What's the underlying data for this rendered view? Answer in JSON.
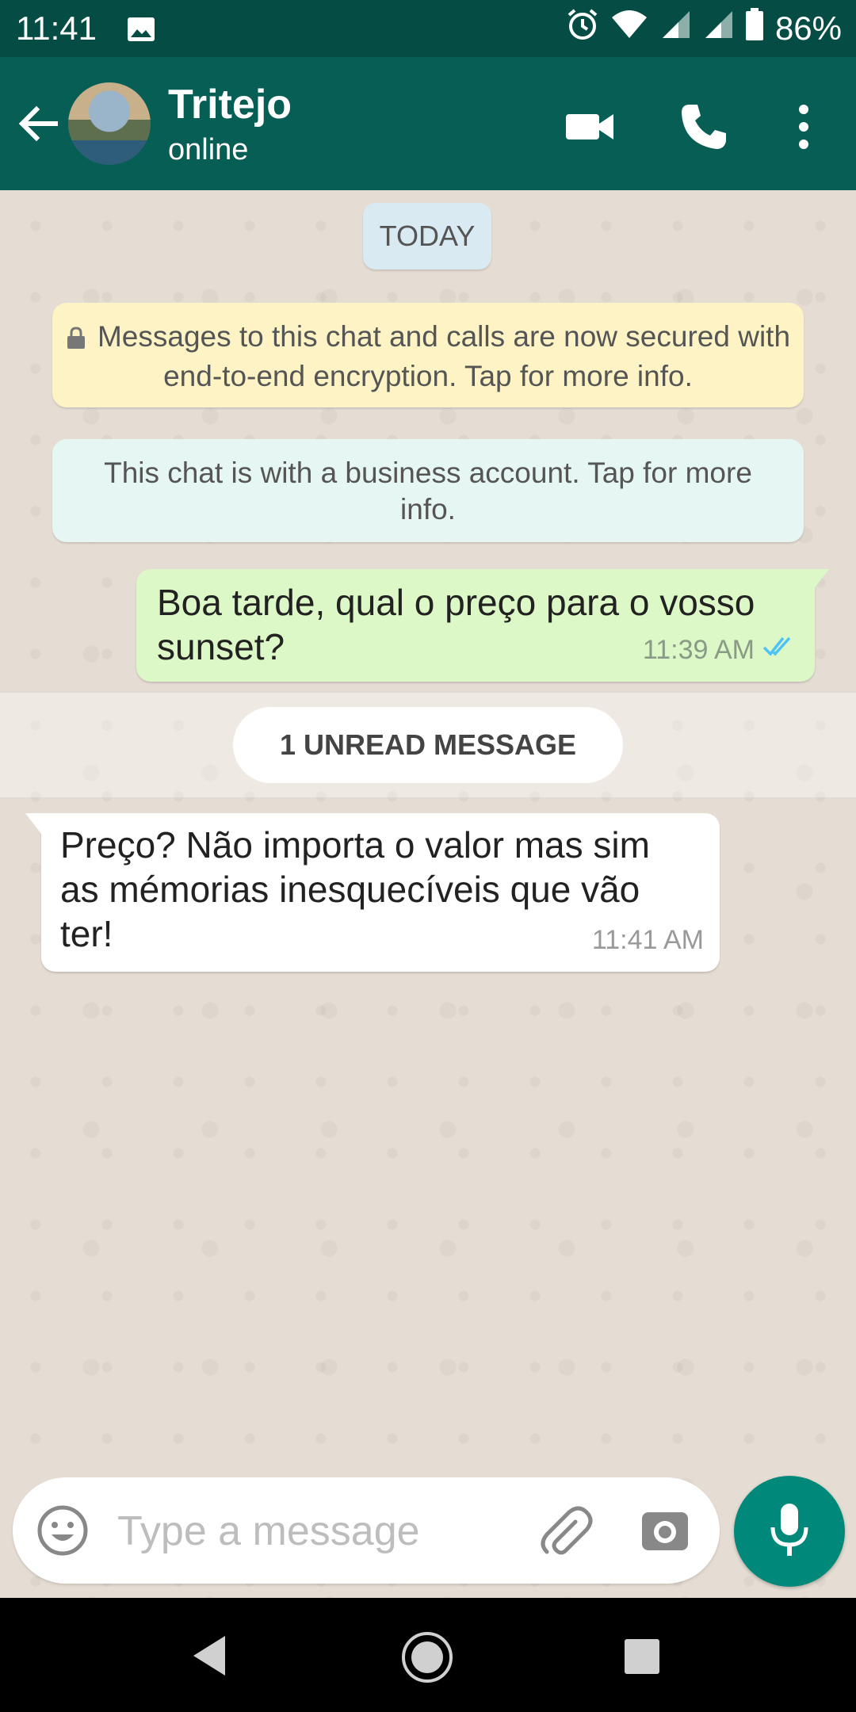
{
  "status_bar": {
    "time": "11:41",
    "battery_pct": "86%",
    "icons": [
      "image-icon",
      "alarm-icon",
      "wifi-icon",
      "signal-icon",
      "signal-icon",
      "battery-icon"
    ]
  },
  "header": {
    "contact_name": "Tritejo",
    "status": "online",
    "icons": [
      "back-arrow-icon",
      "video-call-icon",
      "phone-icon",
      "more-vert-icon"
    ]
  },
  "chat": {
    "date_chip": "TODAY",
    "encryption_notice": "Messages to this chat and calls are now secured with end-to-end encryption. Tap for more info.",
    "business_notice": "This chat is with a business account. Tap for more info.",
    "messages": [
      {
        "direction": "outgoing",
        "text": "Boa tarde, qual o preço para o vosso sunset?",
        "time": "11:39 AM",
        "read_receipt": "double-check-read"
      },
      {
        "direction": "incoming",
        "text": "Preço? Não importa o valor mas sim as mémorias inesquecíveis que vão ter!",
        "time": "11:41 AM"
      }
    ],
    "unread_label": "1 UNREAD MESSAGE"
  },
  "composer": {
    "placeholder": "Type a message",
    "icons": [
      "emoji-icon",
      "attach-icon",
      "camera-icon",
      "mic-icon"
    ]
  },
  "colors": {
    "status_bar": "#054d44",
    "app_bar": "#075e54",
    "outgoing_bubble": "#dcf8c6",
    "incoming_bubble": "#ffffff",
    "accent": "#00897b",
    "read_tick": "#4fc3f7"
  }
}
